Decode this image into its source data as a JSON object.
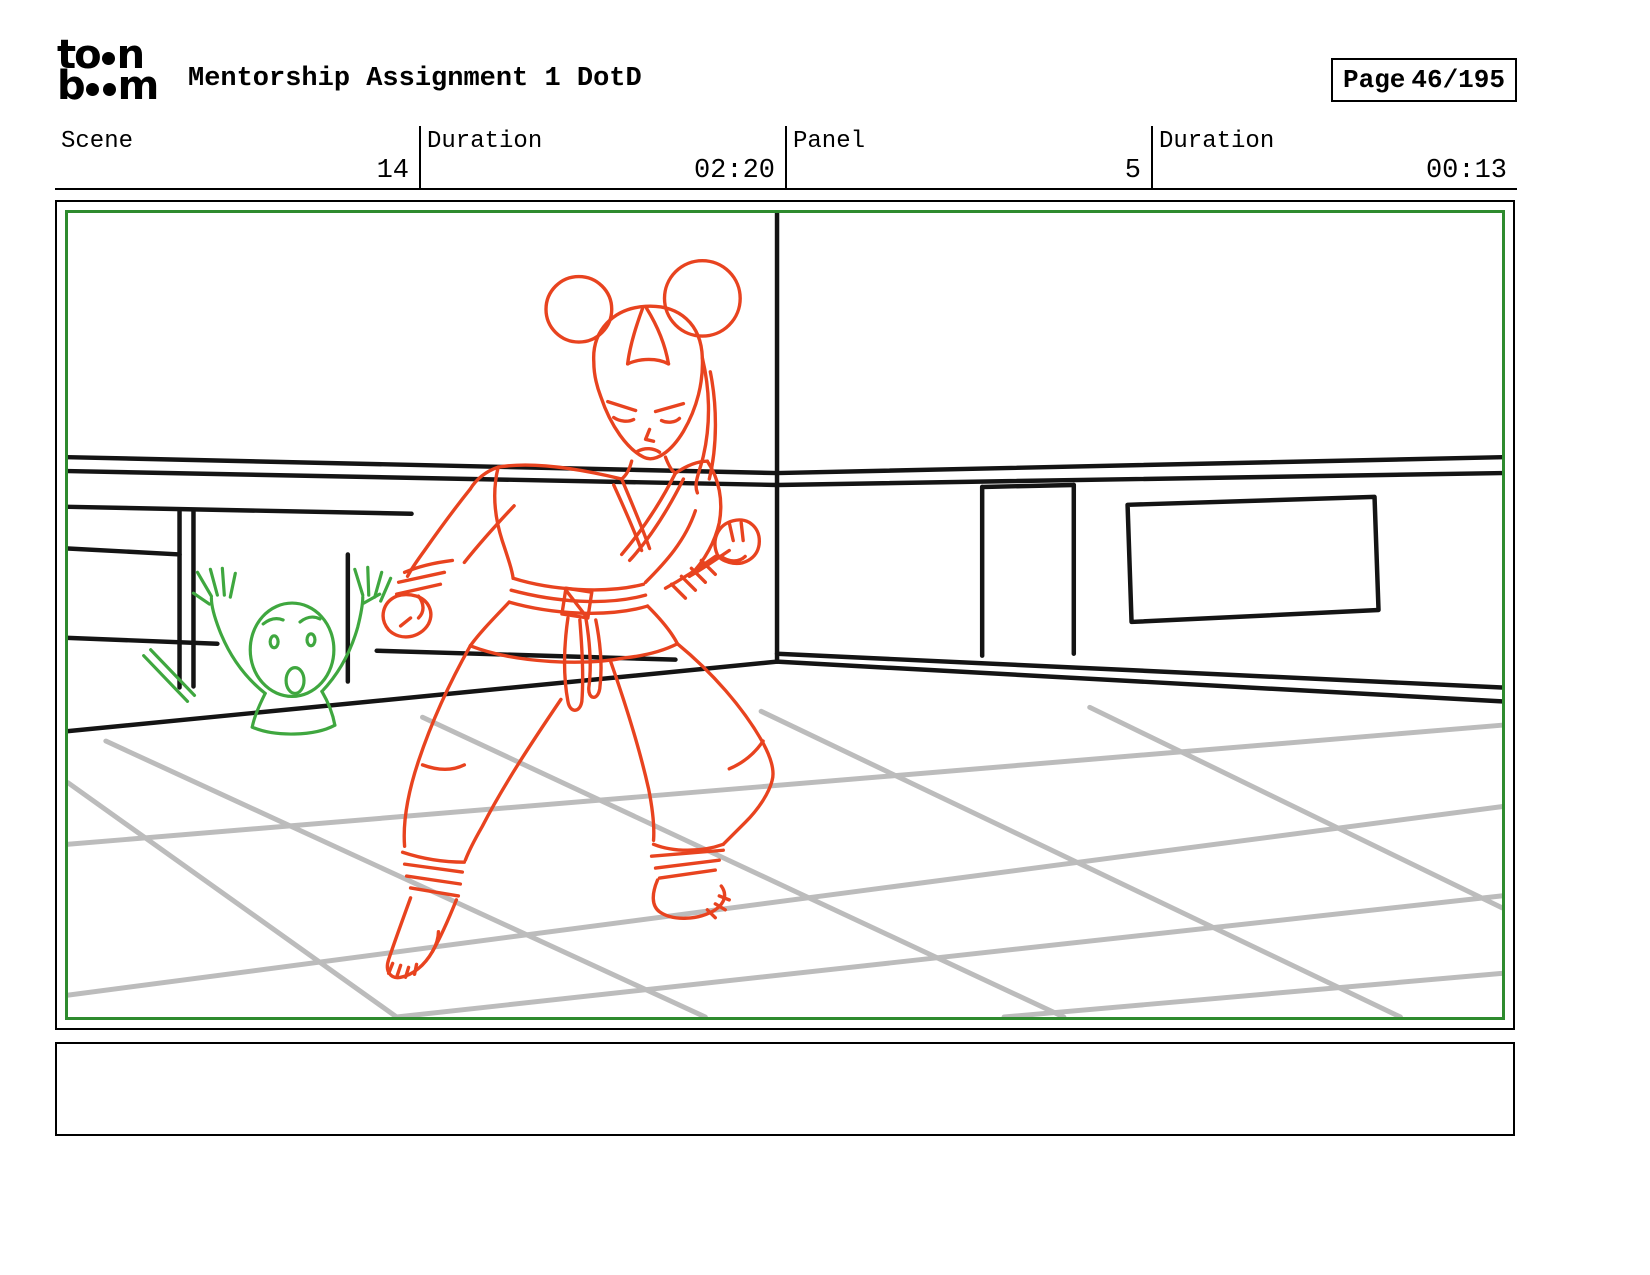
{
  "colors": {
    "sketch_orange": "#e8431f",
    "sketch_green": "#3fa73f",
    "frame_green": "#2e8b2e",
    "floor_gray": "#bcbcbc",
    "ink": "#141414"
  },
  "header": {
    "logo": {
      "top_pre": "t",
      "top_o": "o",
      "top_post": "n",
      "bottom_pre": "b",
      "bottom_m": "m"
    },
    "title": "Mentorship Assignment 1 DotD",
    "page_label": "Page",
    "page_value": "46/195"
  },
  "info_bar": {
    "cells": [
      {
        "label": "Scene",
        "value": "14"
      },
      {
        "label": "Duration",
        "value": "02:20"
      },
      {
        "label": "Panel",
        "value": "5"
      },
      {
        "label": "Duration",
        "value": "00:13"
      }
    ]
  },
  "caption": {
    "text": ""
  }
}
